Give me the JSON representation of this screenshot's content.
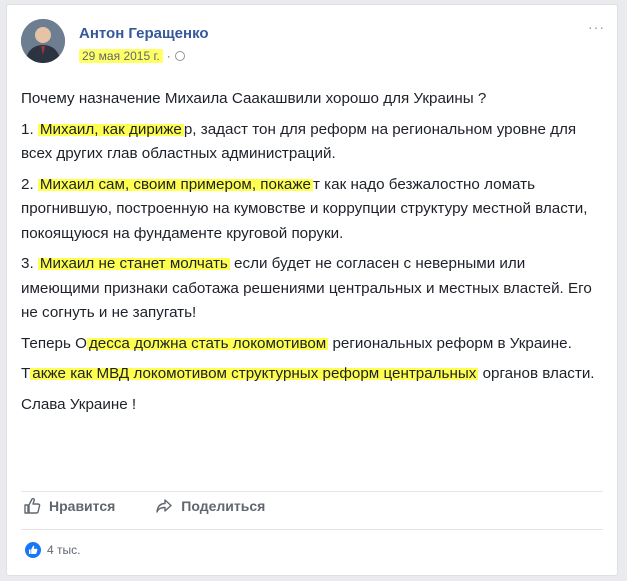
{
  "post": {
    "author": "Антон Геращенко",
    "date": "29 мая 2015 г.",
    "separator": "·",
    "more": "···",
    "paragraphs": [
      [
        "Почему назначение Михаила Саакашвили хорошо для Украины ?"
      ],
      [
        "1. ",
        {
          "hl": "Михаил, как дириже"
        },
        "р, задаст тон для реформ на региональном уровне для всех других глав областных администраций."
      ],
      [
        "2. ",
        {
          "hl": "Михаил сам, своим примером, покаже"
        },
        "т как надо безжалостно ломать прогнившую, построенную на кумовстве и коррупции структуру местной власти, покоящуюся на фундаменте круговой поруки."
      ],
      [
        "3. ",
        {
          "hl": "Михаил не станет молчать"
        },
        " если будет не согласен с неверными или имеющими признаки саботажа решениями центральных и местных властей. Его не согнуть и не запугать!"
      ],
      [
        "Теперь О",
        {
          "hl": "десса должна стать локомотивом"
        },
        " региональных реформ в Украине."
      ],
      [
        "Т",
        {
          "hl": "акже как МВД локомотивом структурных реформ центральных"
        },
        " органов власти."
      ],
      [
        "Слава Украине !"
      ]
    ]
  },
  "actions": {
    "like_label": "Нравится",
    "share_label": "Поделиться"
  },
  "reactions": {
    "count": "4 тыс."
  },
  "colors": {
    "highlight": "#ffff50",
    "author": "#365899",
    "like_badge": "#1877f2"
  }
}
